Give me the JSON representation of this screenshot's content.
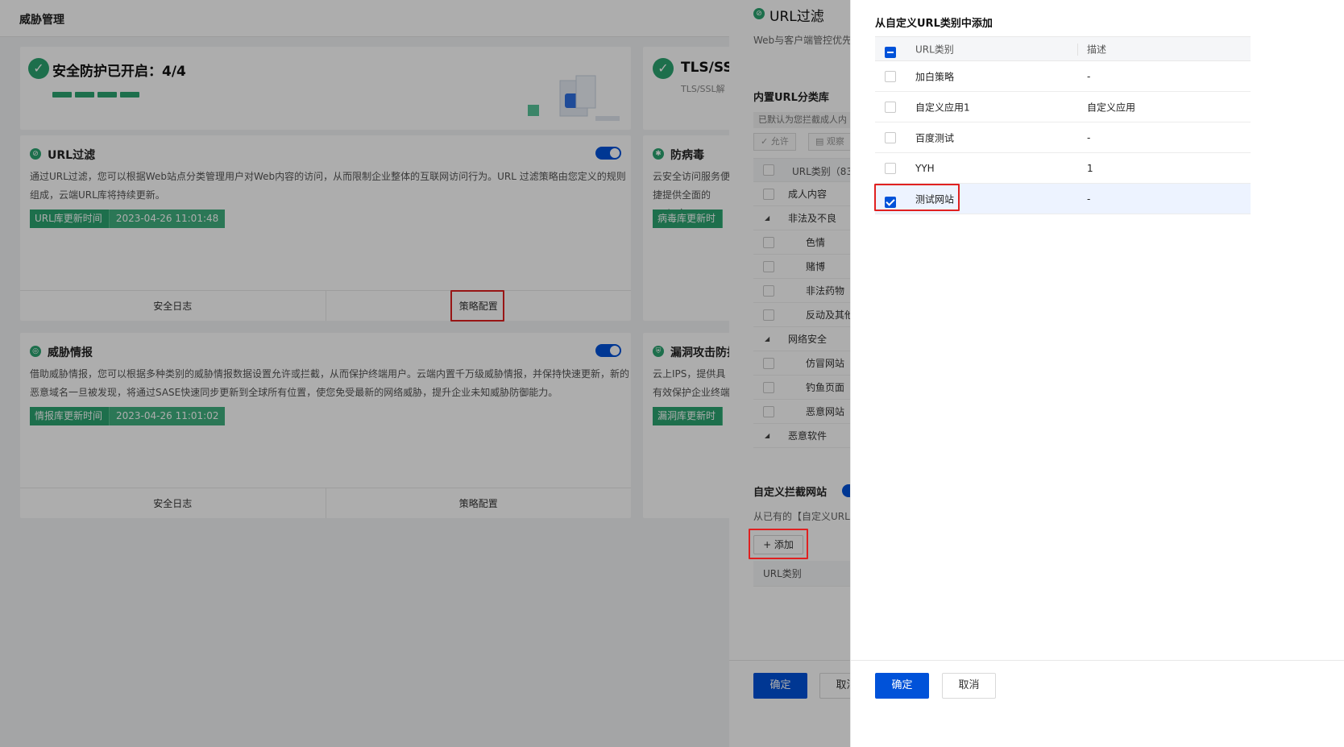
{
  "page": {
    "title": "威胁管理"
  },
  "overview": [
    {
      "title": "安全防护已开启：4/4",
      "subtitle": ""
    },
    {
      "title": "TLS/SSL",
      "subtitle": "TLS/SSL解"
    }
  ],
  "features": {
    "url_filter": {
      "title": "URL过滤",
      "desc": "通过URL过滤，您可以根据Web站点分类管理用户对Web内容的访问，从而限制企业整体的互联网访问行为。URL 过滤策略由您定义的规则组成，云端URL库将持续更新。",
      "badge_label": "URL库更新时间",
      "badge_value": "2023-04-26 11:01:48",
      "footer_left": "安全日志",
      "footer_right": "策略配置"
    },
    "threat_intel": {
      "title": "威胁情报",
      "desc": "借助威胁情报，您可以根据多种类别的威胁情报数据设置允许或拦截，从而保护终端用户。云端内置千万级威胁情报，并保持快速更新，新的恶意域名一旦被发现，将通过SASE快速同步更新到全球所有位置，使您免受最新的网络威胁，提升企业未知威胁防御能力。",
      "badge_label": "情报库更新时间",
      "badge_value": "2023-04-26 11:01:02",
      "footer_left": "安全日志",
      "footer_right": "策略配置"
    },
    "antivirus": {
      "title": "防病毒",
      "desc": "云安全访问服务便捷提供全面的 Web 安",
      "badge_label": "病毒库更新时"
    },
    "ips": {
      "title": "漏洞攻击防护",
      "desc": "云上IPS，提供具有效保护企业终端",
      "badge_label": "漏洞库更新时"
    }
  },
  "drawer_mid": {
    "title": "URL过滤",
    "desc": "Web与客户端管控优先于Web访问。匹配命中URL",
    "section": "内置URL分类库",
    "note": "已默认为您拦截成人内",
    "btn_allow": "允许",
    "btn_observe": "观察",
    "table_header": "URL类别（83",
    "rows": [
      {
        "label": "成人内容",
        "level": 0,
        "expand": false
      },
      {
        "label": "非法及不良",
        "level": 0,
        "expand": true
      },
      {
        "label": "色情",
        "level": 1,
        "expand": false
      },
      {
        "label": "赌博",
        "level": 1,
        "expand": false
      },
      {
        "label": "非法药物",
        "level": 1,
        "expand": false
      },
      {
        "label": "反动及其他",
        "level": 1,
        "expand": false
      },
      {
        "label": "网络安全",
        "level": 0,
        "expand": true
      },
      {
        "label": "仿冒网站",
        "level": 1,
        "expand": false
      },
      {
        "label": "钓鱼页面",
        "level": 1,
        "expand": false
      },
      {
        "label": "恶意网站",
        "level": 1,
        "expand": false
      },
      {
        "label": "恶意软件",
        "level": 0,
        "expand": true
      }
    ],
    "custom_section": "自定义拦截网站",
    "custom_sub": "从已有的【自定义URL类",
    "add_button": "+ 添加",
    "custom_table_header": "URL类别",
    "confirm": "确定",
    "cancel": "取消"
  },
  "drawer_right": {
    "title": "从自定义URL类别中添加",
    "header_name": "URL类别",
    "header_desc": "描述",
    "rows": [
      {
        "name": "加白策略",
        "desc": "-",
        "checked": false
      },
      {
        "name": "自定义应用1",
        "desc": "自定义应用",
        "checked": false
      },
      {
        "name": "百度测试",
        "desc": "-",
        "checked": false
      },
      {
        "name": "YYH",
        "desc": "1",
        "checked": false
      },
      {
        "name": "测试网站",
        "desc": "-",
        "checked": true
      }
    ],
    "confirm": "确定",
    "cancel": "取消"
  },
  "colors": {
    "primary": "#0052d9",
    "success": "#2ba471",
    "annotation": "#e02020"
  }
}
